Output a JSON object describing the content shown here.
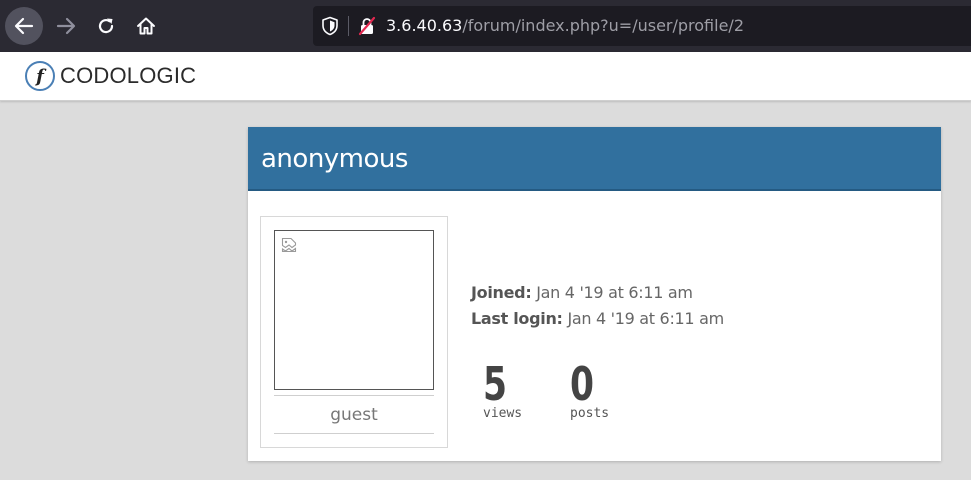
{
  "browser": {
    "url_host": "3.6.40.63",
    "url_path": "/forum/index.php?u=/user/profile/2"
  },
  "site": {
    "logo_letter": "f",
    "logo_text": "CODOLOGIC",
    "accent_color": "#31709e"
  },
  "profile": {
    "username": "anonymous",
    "role": "guest",
    "joined_label": "Joined:",
    "joined_value": "Jan 4 '19 at 6:11 am",
    "last_login_label": "Last login:",
    "last_login_value": "Jan 4 '19 at 6:11 am",
    "stats": [
      {
        "value": "5",
        "label": "views"
      },
      {
        "value": "0",
        "label": "posts"
      }
    ]
  },
  "icons": [
    "back-arrow-icon",
    "forward-arrow-icon",
    "reload-icon",
    "home-icon",
    "shield-icon",
    "insecure-lock-icon",
    "broken-image-icon"
  ]
}
